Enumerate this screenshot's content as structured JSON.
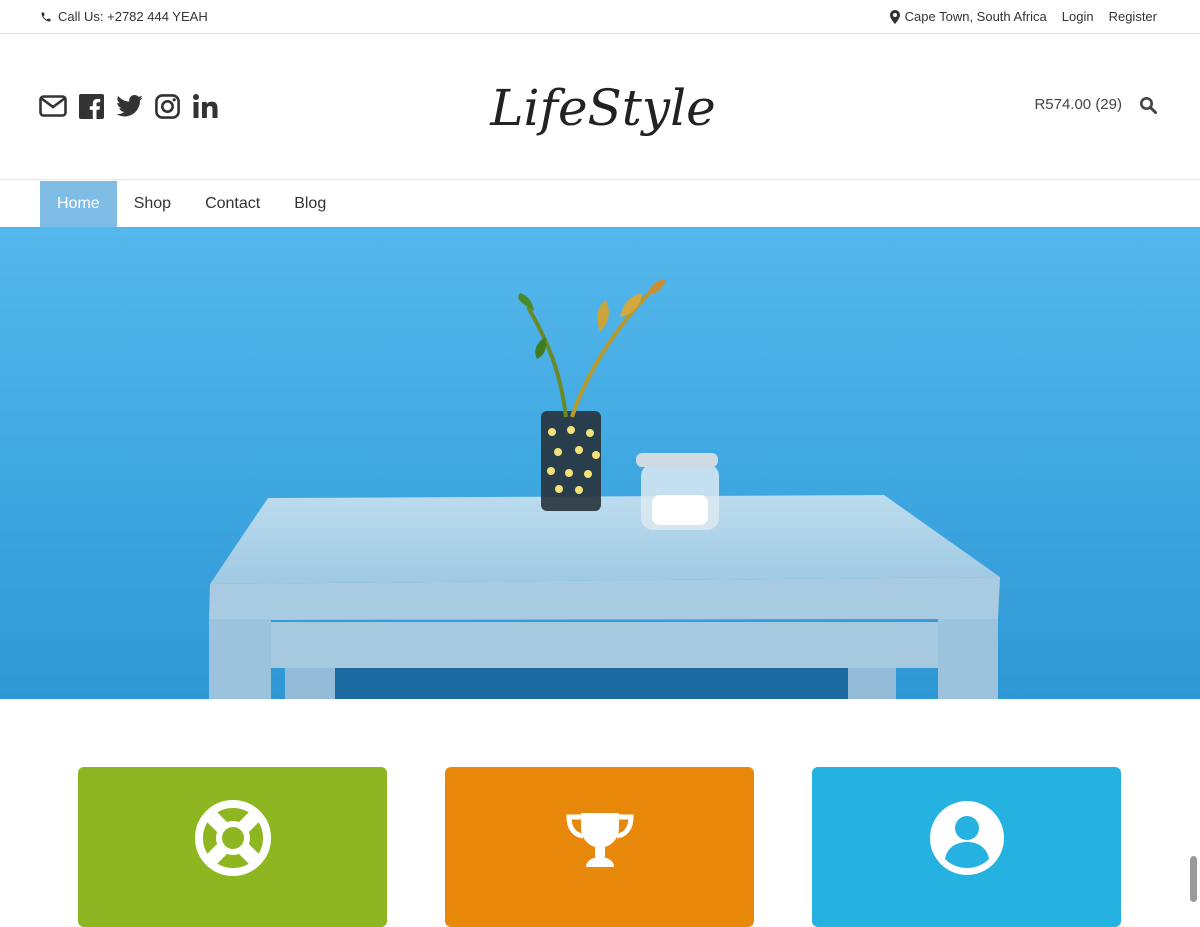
{
  "topbar": {
    "call": "Call Us: +2782 444 YEAH",
    "location": "Cape Town, South Africa",
    "login": "Login",
    "register": "Register"
  },
  "header": {
    "logo_text": "LifeStyle",
    "cart": "R574.00 (29)",
    "social_icons": [
      "envelope-icon",
      "facebook-icon",
      "twitter-icon",
      "instagram-icon",
      "linkedin-icon"
    ]
  },
  "nav": {
    "items": [
      {
        "label": "Home",
        "active": true
      },
      {
        "label": "Shop",
        "active": false
      },
      {
        "label": "Contact",
        "active": false
      },
      {
        "label": "Blog",
        "active": false
      }
    ]
  },
  "tiles": [
    {
      "icon": "lifebuoy-icon",
      "color": "#8db621"
    },
    {
      "icon": "trophy-icon",
      "color": "#e8880a"
    },
    {
      "icon": "user-icon",
      "color": "#25b2e0"
    }
  ],
  "colors": {
    "accent": "#7fbde6",
    "hero_wall": "#3aa4dd",
    "hero_table": "#a9cde4"
  }
}
